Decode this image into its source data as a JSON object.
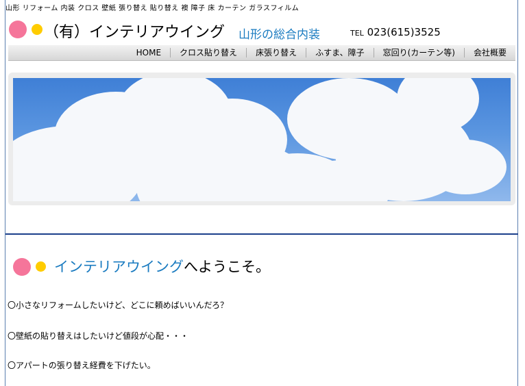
{
  "header": {
    "tagline": "山形 リフォーム 内装 クロス 壁紙 張り替え 貼り替え 襖 障子 床 カーテン ガラスフィルム",
    "company_name": "（有）インテリアウイング",
    "subtitle": "山形の総合内装",
    "phone_prefix": "TEL",
    "phone_number": "023(615)3525"
  },
  "nav": {
    "items": [
      "HOME",
      "クロス貼り替え",
      "床張り替え",
      "ふすま、障子",
      "窓回り(カーテン等)",
      "会社概要"
    ]
  },
  "welcome": {
    "brand": "インテリアウイング",
    "rest": "へようこそ。"
  },
  "questions": [
    "〇小さなリフォームしたいけど、どこに頼めばいいんだろ？",
    "〇壁紙の貼り替えはしたいけど値段が心配・・・",
    "〇アパートの張り替え経費を下げたい。"
  ],
  "colors": {
    "accent_blue": "#1a7bc0",
    "logo_pink": "#f5759a",
    "logo_yellow": "#ffcc00",
    "divider": "#1a3e8a"
  },
  "icons": [
    "pink-dot-icon",
    "yellow-dot-icon"
  ]
}
